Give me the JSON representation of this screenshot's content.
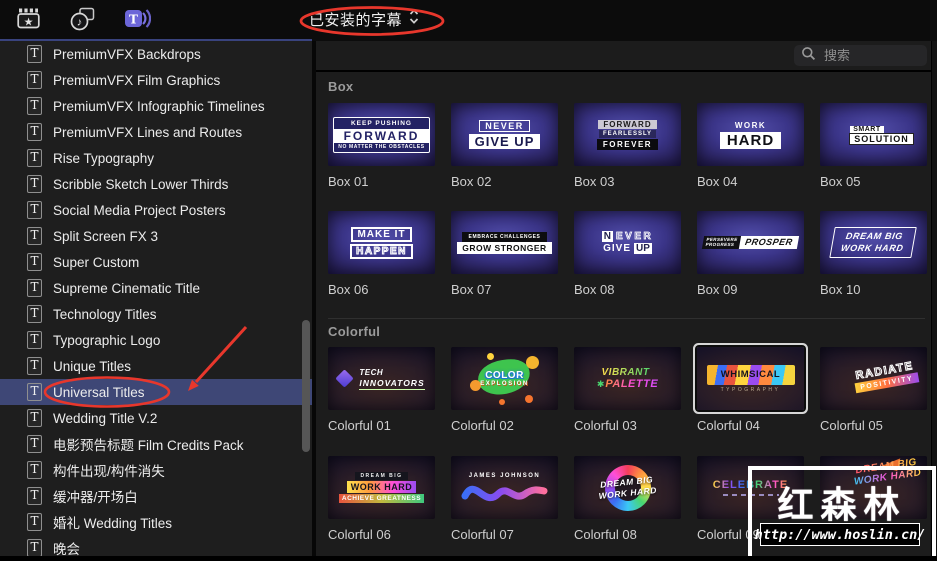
{
  "toolbar": {
    "icons": [
      {
        "name": "effects-browser",
        "active": false
      },
      {
        "name": "photos-audio-browser",
        "active": false
      },
      {
        "name": "titles-generators-browser",
        "active": true
      }
    ],
    "dropdown_label": "已安装的字幕"
  },
  "search": {
    "placeholder": "搜索"
  },
  "sidebar": {
    "t_glyph": "T",
    "items": [
      {
        "label": "PremiumVFX Backdrops",
        "selected": false
      },
      {
        "label": "PremiumVFX Film Graphics",
        "selected": false
      },
      {
        "label": "PremiumVFX Infographic Timelines",
        "selected": false
      },
      {
        "label": "PremiumVFX Lines and Routes",
        "selected": false
      },
      {
        "label": "Rise Typography",
        "selected": false
      },
      {
        "label": "Scribble Sketch Lower Thirds",
        "selected": false
      },
      {
        "label": "Social Media Project Posters",
        "selected": false
      },
      {
        "label": "Split Screen FX 3",
        "selected": false
      },
      {
        "label": "Super Custom",
        "selected": false
      },
      {
        "label": "Supreme Cinematic Title",
        "selected": false
      },
      {
        "label": "Technology Titles",
        "selected": false
      },
      {
        "label": "Typographic Logo",
        "selected": false
      },
      {
        "label": "Unique Titles",
        "selected": false
      },
      {
        "label": "Universal Titles",
        "selected": true
      },
      {
        "label": "Wedding Title V.2",
        "selected": false
      },
      {
        "label": "电影预告标题 Film Credits Pack",
        "selected": false
      },
      {
        "label": "构件出现/构件消失",
        "selected": false
      },
      {
        "label": "缓冲器/开场白",
        "selected": false
      },
      {
        "label": "婚礼 Wedding Titles",
        "selected": false
      },
      {
        "label": "晚会",
        "selected": false
      }
    ]
  },
  "content": {
    "sections": [
      {
        "title": "Box",
        "items": [
          {
            "label": "Box 01",
            "lines": [
              "KEEP PUSHING",
              "FORWARD",
              "NO MATTER THE OBSTACLES"
            ]
          },
          {
            "label": "Box 02",
            "lines": [
              "NEVER",
              "GIVE UP"
            ]
          },
          {
            "label": "Box 03",
            "lines": [
              "FORWARD",
              "FEARLESSLY",
              "FOREVER"
            ]
          },
          {
            "label": "Box 04",
            "lines": [
              "WORK",
              "HARD"
            ]
          },
          {
            "label": "Box 05",
            "lines": [
              "SMART",
              "SOLUTION"
            ]
          },
          {
            "label": "Box 06",
            "lines": [
              "MAKE IT",
              "HAPPEN"
            ]
          },
          {
            "label": "Box 07",
            "lines": [
              "EMBRACE CHALLENGES",
              "GROW STRONGER"
            ]
          },
          {
            "label": "Box 08",
            "lines": [
              "N",
              "EVER",
              "GIVE",
              "UP"
            ]
          },
          {
            "label": "Box 09",
            "lines": [
              "PERSEVERE",
              "PROGRESS",
              "PROSPER"
            ]
          },
          {
            "label": "Box 10",
            "lines": [
              "DREAM BIG",
              "WORK HARD"
            ]
          }
        ]
      },
      {
        "title": "Colorful",
        "items": [
          {
            "label": "Colorful 01",
            "lines": [
              "TECH",
              "INNOVATORS"
            ]
          },
          {
            "label": "Colorful 02",
            "lines": [
              "COLOR",
              "EXPLOSION"
            ]
          },
          {
            "label": "Colorful 03",
            "lines": [
              "VIBRANT",
              "PALETTE"
            ]
          },
          {
            "label": "Colorful 04",
            "lines": [
              "WHIMSICAL",
              "TYPOGRAPHY"
            ],
            "selected": true
          },
          {
            "label": "Colorful 05",
            "lines": [
              "RADIATE",
              "POSITIVITY"
            ]
          },
          {
            "label": "Colorful 06",
            "lines": [
              "DREAM BIG",
              "WORK HARD",
              "ACHIEVE GREATNESS"
            ]
          },
          {
            "label": "Colorful 07",
            "lines": [
              "JAMES JOHNSON"
            ]
          },
          {
            "label": "Colorful 08",
            "lines": [
              "DREAM BIG",
              "WORK HARD"
            ]
          },
          {
            "label": "Colorful 09",
            "lines": [
              "CELEBRATE"
            ]
          },
          {
            "label": "",
            "lines": [
              "DREAM BIG",
              "WORK HARD"
            ]
          }
        ]
      }
    ]
  },
  "watermark": {
    "brand": "红森林",
    "url": "http://www.hoslin.cn/"
  },
  "annotations": {
    "color": "#e8372c",
    "circled": [
      "已安装的字幕",
      "Universal Titles"
    ],
    "arrow_points_to": "Universal Titles"
  }
}
